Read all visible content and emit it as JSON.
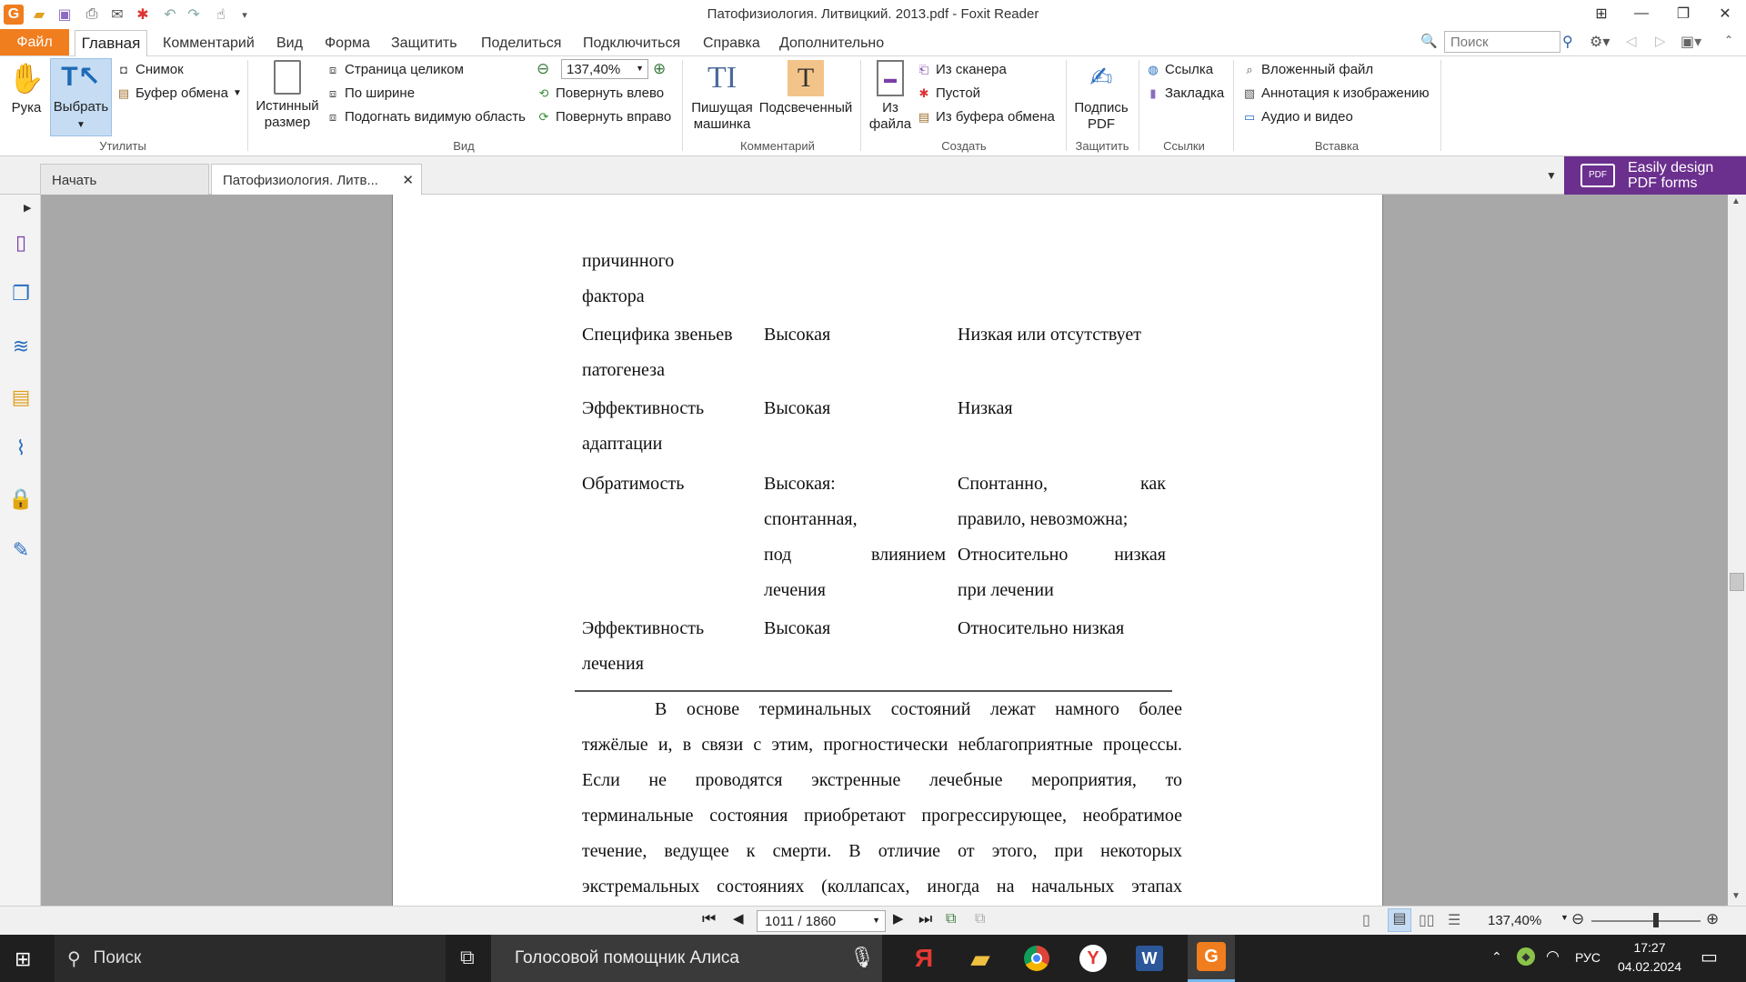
{
  "app": {
    "title": "Патофизиология. Литвицкий. 2013.pdf - Foxit Reader"
  },
  "menu": {
    "file": "Файл",
    "items": [
      "Главная",
      "Комментарий",
      "Вид",
      "Форма",
      "Защитить",
      "Поделиться",
      "Подключиться",
      "Справка",
      "Дополнительно"
    ],
    "search_placeholder": "Поиск"
  },
  "ribbon": {
    "utilities": {
      "hand": "Рука",
      "select": "Выбрать",
      "snapshot": "Снимок",
      "clipboard": "Буфер обмена",
      "label": "Утилиты"
    },
    "view": {
      "actual_size_1": "Истинный",
      "actual_size_2": "размер",
      "fit_page": "Страница целиком",
      "fit_width": "По ширине",
      "fit_visible": "Подогнать видимую область",
      "zoom": "137,40%",
      "rotate_left": "Повернуть влево",
      "rotate_right": "Повернуть вправо",
      "label": "Вид"
    },
    "comment": {
      "typewriter_1": "Пишущая",
      "typewriter_2": "машинка",
      "highlight": "Подсвеченный",
      "label": "Комментарий"
    },
    "create": {
      "from_file_1": "Из",
      "from_file_2": "файла",
      "from_scanner": "Из сканера",
      "blank": "Пустой",
      "from_clipboard": "Из буфера обмена",
      "label": "Создать"
    },
    "protect": {
      "sign_1": "Подпись",
      "sign_2": "PDF",
      "label": "Защитить"
    },
    "links": {
      "link": "Ссылка",
      "bookmark": "Закладка",
      "label": "Ссылки"
    },
    "insert": {
      "attachment": "Вложенный файл",
      "image_annotation": "Аннотация к изображению",
      "audio_video": "Аудио и видео",
      "label": "Вставка"
    }
  },
  "tabs": {
    "start": "Начать",
    "document": "Патофизиология. Литв..."
  },
  "promo": {
    "line1": "Easily design",
    "line2": "PDF forms"
  },
  "document": {
    "table_rows": [
      {
        "c1": [
          "причинного",
          "фактора"
        ],
        "c2": [],
        "c3": []
      },
      {
        "c1": [
          "Специфика звеньев",
          "патогенеза"
        ],
        "c2": [
          "Высокая"
        ],
        "c3": [
          "Низкая или отсутствует"
        ]
      },
      {
        "c1": [
          "Эффективность",
          "адаптации"
        ],
        "c2": [
          "Высокая"
        ],
        "c3": [
          "Низкая"
        ]
      },
      {
        "c1": [
          "Обратимость"
        ],
        "c2": [
          "Высокая:",
          "спонтанная,",
          "под влиянием",
          "лечения"
        ],
        "c3": [
          "Спонтанно, как",
          "правило, невозможна;",
          "Относительно низкая",
          "при лечении"
        ]
      },
      {
        "c1": [
          "Эффективность",
          "лечения"
        ],
        "c2": [
          "Высокая"
        ],
        "c3": [
          "Относительно низкая"
        ]
      }
    ],
    "paragraph": [
      "В основе терминальных состояний лежат намного более",
      "тяжёлые и, в связи с этим, прогностически неблагоприятные процессы.",
      "Если не проводятся экстренные лечебные мероприятия, то",
      "терминальные состояния приобретают прогрессирующее, необратимое",
      "течение, ведущее к смерти. В отличие от этого, при некоторых",
      "экстремальных состояниях (коллапсах, иногда на начальных этапах"
    ]
  },
  "status": {
    "page": "1011 / 1860",
    "zoom": "137,40%"
  },
  "taskbar": {
    "search": "Поиск",
    "assistant": "Голосовой помощник Алиса",
    "lang": "РУС",
    "time": "17:27",
    "date": "04.02.2024"
  }
}
